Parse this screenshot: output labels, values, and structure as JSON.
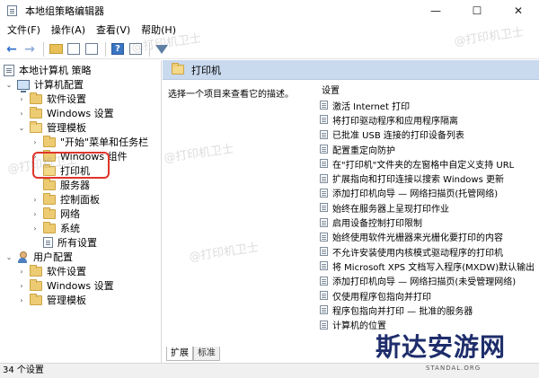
{
  "window": {
    "title": "本地组策略编辑器",
    "controls": [
      "—",
      "☐",
      "✕"
    ]
  },
  "menu": [
    "文件(F)",
    "操作(A)",
    "查看(V)",
    "帮助(H)"
  ],
  "tree": {
    "root": "本地计算机 策略",
    "computer_config": "计算机配置",
    "items": [
      "软件设置",
      "Windows 设置",
      "管理模板",
      "\"开始\"菜单和任务栏",
      "Windows 组件",
      "打印机",
      "服务器",
      "控制面板",
      "网络",
      "系统",
      "所有设置"
    ],
    "user_config": "用户配置",
    "user_items": [
      "软件设置",
      "Windows 设置",
      "管理模板"
    ]
  },
  "right": {
    "header": "打印机",
    "description": "选择一个项目来查看它的描述。",
    "column_header": "设置",
    "policies": [
      "激活 Internet 打印",
      "将打印驱动程序和应用程序隔离",
      "已批准 USB 连接的打印设备列表",
      "配置重定向防护",
      "在\"打印机\"文件夹的左窗格中自定义支持 URL",
      "扩展指向和打印连接以搜索 Windows 更新",
      "添加打印机向导 — 网络扫描页(托管网络)",
      "始终在服务器上呈现打印作业",
      "启用设备控制打印限制",
      "始终使用软件光栅器来光栅化要打印的内容",
      "不允许安装使用内核模式驱动程序的打印机",
      "将 Microsoft XPS 文档写入程序(MXDW)默认输出",
      "添加打印机向导 — 网络扫描页(未受管理网络)",
      "仅使用程序包指向并打印",
      "程序包指向并打印 — 批准的服务器",
      "计算机的位置"
    ],
    "tabs": [
      "扩展",
      "标准"
    ]
  },
  "status": "34 个设置",
  "watermarks": [
    "@打印机卫士",
    "@打印机卫士",
    "@打印机卫士",
    "@打印机卫士",
    "@打印机卫士"
  ],
  "brand": {
    "title": "斯达安游网",
    "subtitle": "STANDAL.ORG"
  }
}
